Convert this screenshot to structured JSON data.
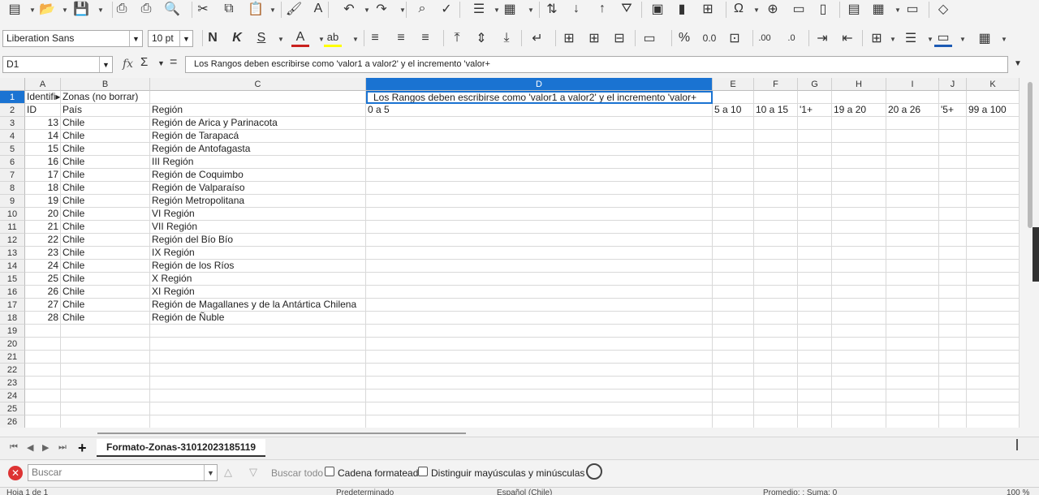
{
  "toolbar_icons": [
    "new-icon",
    "open-icon",
    "save-icon",
    "export-pdf-icon",
    "print-icon",
    "print-preview-icon",
    "cut-icon",
    "copy-icon",
    "paste-icon",
    "clone-format-icon",
    "clear-format-icon",
    "undo-icon",
    "redo-icon",
    "find-replace-icon",
    "spellcheck-icon",
    "row-icon",
    "column-icon",
    "sort-icon",
    "sort-asc-icon",
    "sort-desc-icon",
    "autofilter-icon",
    "image-icon",
    "chart-icon",
    "pivot-icon",
    "special-char-icon",
    "hyperlink-icon",
    "comment-icon",
    "header-footer-icon",
    "define-print-area-icon",
    "freeze-icon",
    "split-window-icon",
    "draw-icon"
  ],
  "format": {
    "font_name": "Liberation Sans",
    "font_size": "10 pt",
    "bold": "N",
    "italic": "K",
    "underline": "S",
    "percent": "%",
    "decimal": "0.0"
  },
  "formula_bar": {
    "name_box": "D1",
    "fx": "fx",
    "sigma": "Σ",
    "equals": "=",
    "content": "Los Rangos deben escribirse como 'valor1 a valor2' y el incremento 'valor+"
  },
  "columns": [
    {
      "id": "A",
      "selected": false
    },
    {
      "id": "B",
      "selected": false
    },
    {
      "id": "C",
      "selected": false
    },
    {
      "id": "D",
      "selected": true
    },
    {
      "id": "E",
      "selected": false
    },
    {
      "id": "F",
      "selected": false
    },
    {
      "id": "G",
      "selected": false
    },
    {
      "id": "H",
      "selected": false
    },
    {
      "id": "I",
      "selected": false
    },
    {
      "id": "J",
      "selected": false
    },
    {
      "id": "K",
      "selected": false
    }
  ],
  "row_numbers": [
    "1",
    "2",
    "3",
    "4",
    "5",
    "6",
    "7",
    "8",
    "9",
    "10",
    "11",
    "12",
    "13",
    "14",
    "15",
    "16",
    "17",
    "18",
    "19",
    "20",
    "21",
    "22",
    "23",
    "24",
    "25",
    "26"
  ],
  "rows": [
    [
      "Identifi▸",
      "Zonas (no borrar)",
      "",
      "Los Rangos deben escribirse como 'valor1 a valor2' y el incremento 'valor+",
      "",
      "",
      "",
      "",
      "",
      "",
      ""
    ],
    [
      "ID",
      "País",
      "Región",
      "0 a 5",
      "5 a 10",
      "10 a 15",
      "'1+",
      "19 a 20",
      "20 a 26",
      "'5+",
      "99 a 100"
    ],
    [
      "13",
      "Chile",
      "Región de Arica y Parinacota",
      "",
      "",
      "",
      "",
      "",
      "",
      "",
      ""
    ],
    [
      "14",
      "Chile",
      "Región de Tarapacá",
      "",
      "",
      "",
      "",
      "",
      "",
      "",
      ""
    ],
    [
      "15",
      "Chile",
      "Región de Antofagasta",
      "",
      "",
      "",
      "",
      "",
      "",
      "",
      ""
    ],
    [
      "16",
      "Chile",
      "III Región",
      "",
      "",
      "",
      "",
      "",
      "",
      "",
      ""
    ],
    [
      "17",
      "Chile",
      "Región de Coquimbo",
      "",
      "",
      "",
      "",
      "",
      "",
      "",
      ""
    ],
    [
      "18",
      "Chile",
      "Región de Valparaíso",
      "",
      "",
      "",
      "",
      "",
      "",
      "",
      ""
    ],
    [
      "19",
      "Chile",
      "Región Metropolitana",
      "",
      "",
      "",
      "",
      "",
      "",
      "",
      ""
    ],
    [
      "20",
      "Chile",
      "VI Región",
      "",
      "",
      "",
      "",
      "",
      "",
      "",
      ""
    ],
    [
      "21",
      "Chile",
      "VII Región",
      "",
      "",
      "",
      "",
      "",
      "",
      "",
      ""
    ],
    [
      "22",
      "Chile",
      "Región del Bío Bío",
      "",
      "",
      "",
      "",
      "",
      "",
      "",
      ""
    ],
    [
      "23",
      "Chile",
      "IX Región",
      "",
      "",
      "",
      "",
      "",
      "",
      "",
      ""
    ],
    [
      "24",
      "Chile",
      "Región de los Ríos",
      "",
      "",
      "",
      "",
      "",
      "",
      "",
      ""
    ],
    [
      "25",
      "Chile",
      "X Región",
      "",
      "",
      "",
      "",
      "",
      "",
      "",
      ""
    ],
    [
      "26",
      "Chile",
      "XI Región",
      "",
      "",
      "",
      "",
      "",
      "",
      "",
      ""
    ],
    [
      "27",
      "Chile",
      "Región de Magallanes y de la Antártica Chilena",
      "",
      "",
      "",
      "",
      "",
      "",
      "",
      ""
    ],
    [
      "28",
      "Chile",
      "Región de Ñuble",
      "",
      "",
      "",
      "",
      "",
      "",
      "",
      ""
    ]
  ],
  "sheet_tabs": {
    "add": "+",
    "active": "Formato-Zonas-31012023185119"
  },
  "find_bar": {
    "placeholder": "Buscar",
    "find_all": "Buscar todo",
    "formatted": "Cadena formateada",
    "match_case": "Distinguir mayúsculas y minúsculas"
  },
  "status_bar": {
    "sheet": "Hoja 1 de 1",
    "page_style": "Predeterminado",
    "language": "Español (Chile)",
    "summary": "Promedio: ; Suma: 0",
    "zoom": "100 %"
  }
}
